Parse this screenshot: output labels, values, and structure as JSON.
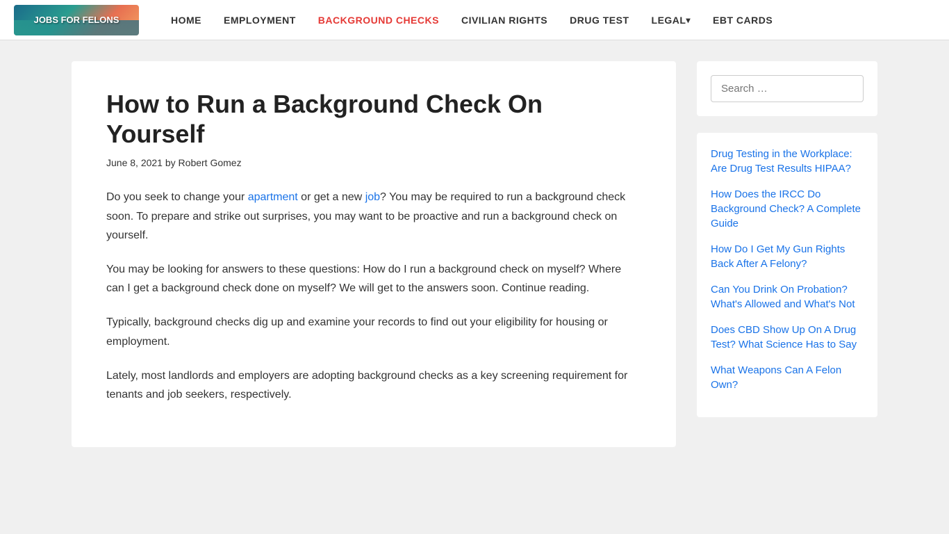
{
  "nav": {
    "logo_text": "JOBS FOR FELONS",
    "links": [
      {
        "label": "HOME",
        "active": false,
        "has_dropdown": false
      },
      {
        "label": "EMPLOYMENT",
        "active": false,
        "has_dropdown": false
      },
      {
        "label": "BACKGROUND CHECKS",
        "active": true,
        "has_dropdown": false
      },
      {
        "label": "CIVILIAN RIGHTS",
        "active": false,
        "has_dropdown": false
      },
      {
        "label": "DRUG TEST",
        "active": false,
        "has_dropdown": false
      },
      {
        "label": "LEGAL",
        "active": false,
        "has_dropdown": true
      },
      {
        "label": "EBT CARDS",
        "active": false,
        "has_dropdown": false
      }
    ]
  },
  "article": {
    "title": "How to Run a Background Check On Yourself",
    "date": "June 8, 2021",
    "author": "Robert Gomez",
    "by_text": "by",
    "paragraphs": [
      {
        "parts": [
          {
            "type": "text",
            "content": "Do you seek to change your "
          },
          {
            "type": "link",
            "content": "apartment",
            "href": "#"
          },
          {
            "type": "text",
            "content": " or get a new "
          },
          {
            "type": "link",
            "content": "job",
            "href": "#"
          },
          {
            "type": "text",
            "content": "? You may be required to run a background check soon. To prepare and strike out surprises, you may want to be proactive and run a background check on yourself."
          }
        ]
      },
      {
        "parts": [
          {
            "type": "text",
            "content": "You may be looking for answers to these questions: How do I run a background check on myself? Where can I get a background check done on myself? We will get to the answers soon. Continue reading."
          }
        ]
      },
      {
        "parts": [
          {
            "type": "text",
            "content": "Typically, background checks dig up and examine your records to find out your eligibility for housing or employment."
          }
        ]
      },
      {
        "parts": [
          {
            "type": "text",
            "content": "Lately, most landlords and employers are adopting background checks as a key screening requirement for tenants and job seekers, respectively."
          }
        ]
      }
    ]
  },
  "sidebar": {
    "search_placeholder": "Search …",
    "links": [
      {
        "text": "Drug Testing in the Workplace: Are Drug Test Results HIPAA?",
        "href": "#"
      },
      {
        "text": "How Does the IRCC Do Background Check? A Complete Guide",
        "href": "#"
      },
      {
        "text": "How Do I Get My Gun Rights Back After A Felony?",
        "href": "#"
      },
      {
        "text": "Can You Drink On Probation? What's Allowed and What's Not",
        "href": "#"
      },
      {
        "text": "Does CBD Show Up On A Drug Test? What Science Has to Say",
        "href": "#"
      },
      {
        "text": "What Weapons Can A Felon Own?",
        "href": "#"
      }
    ]
  }
}
